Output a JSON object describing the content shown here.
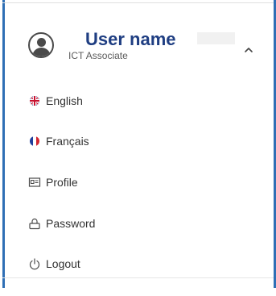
{
  "user": {
    "name": "User name",
    "role": "ICT Associate"
  },
  "menu": [
    {
      "label": "English",
      "icon": "uk-flag-icon"
    },
    {
      "label": "Français",
      "icon": "france-flag-icon"
    },
    {
      "label": "Profile",
      "icon": "id-card-icon"
    },
    {
      "label": "Password",
      "icon": "lock-icon"
    },
    {
      "label": "Logout",
      "icon": "power-icon"
    }
  ],
  "colors": {
    "frame": "#2f6fb5",
    "username": "#1f3e82",
    "text": "#333333",
    "icon": "#4a4a4a"
  }
}
